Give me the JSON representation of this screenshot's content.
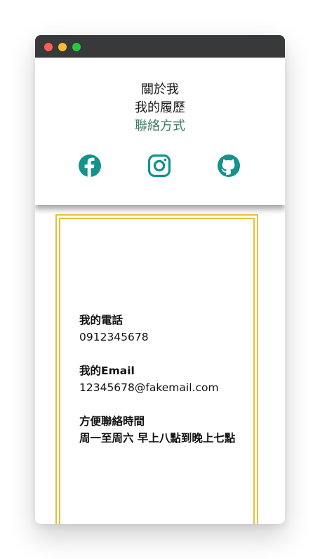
{
  "nav": {
    "items": [
      {
        "label": "關於我"
      },
      {
        "label": "我的履歷"
      },
      {
        "label": "聯絡方式"
      }
    ]
  },
  "socials": {
    "items": [
      {
        "icon": "facebook-icon"
      },
      {
        "icon": "instagram-icon"
      },
      {
        "icon": "github-icon"
      }
    ],
    "color": "#14928c"
  },
  "contact": {
    "phone": {
      "label": "我的電話",
      "value": "0912345678"
    },
    "email": {
      "label": "我的Email",
      "value": "12345678@fakemail.com"
    },
    "hours": {
      "label": "方便聯絡時間",
      "value": "周一至周六 早上八點到晚上七點"
    }
  },
  "colors": {
    "accent": "#3f7d66",
    "frame": "#eabf3c",
    "titlebar": "#38393a"
  }
}
